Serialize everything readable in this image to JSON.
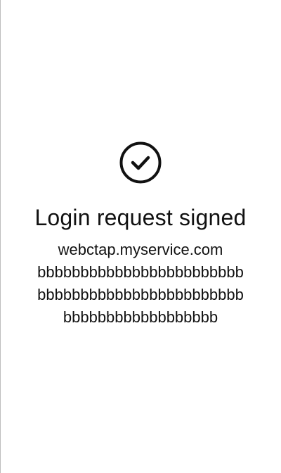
{
  "icon": {
    "name": "check-circle-icon",
    "color": "#111111"
  },
  "title": "Login request signed",
  "message": {
    "domain": "webctap.myservice.com",
    "lines": [
      "bbbbbbbbbbbbbbbbbbbbbbbb",
      "bbbbbbbbbbbbbbbbbbbbbbbb",
      "bbbbbbbbbbbbbbbbbb"
    ]
  }
}
